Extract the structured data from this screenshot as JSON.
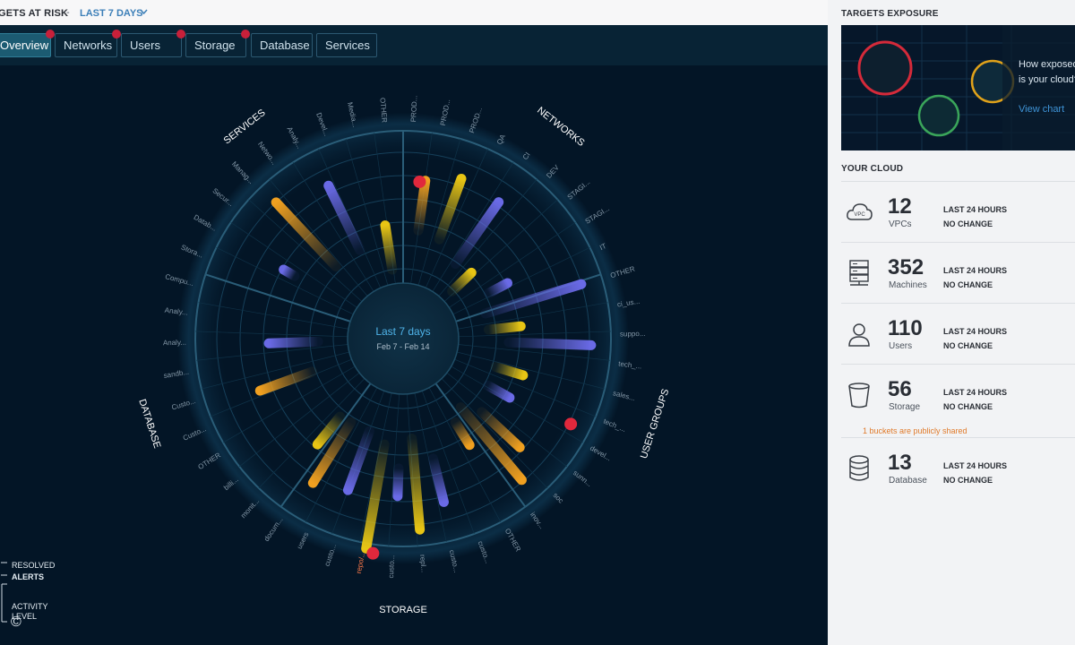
{
  "header": {
    "title": "GETS AT RISK",
    "separator": "-",
    "range_label": "LAST 7 DAYS"
  },
  "tabs": [
    {
      "label": "Overview",
      "active": true,
      "alert": true
    },
    {
      "label": "Networks",
      "active": false,
      "alert": true
    },
    {
      "label": "Users",
      "active": false,
      "alert": true
    },
    {
      "label": "Storage",
      "active": false,
      "alert": true
    },
    {
      "label": "Database",
      "active": false,
      "alert": false
    },
    {
      "label": "Services",
      "active": false,
      "alert": false
    }
  ],
  "radial": {
    "center_title": "Last 7 days",
    "center_dates": "Feb 7 - Feb 14",
    "sections": [
      "SERVICES",
      "NETWORKS",
      "USER GROUPS",
      "STORAGE",
      "DATABASE"
    ],
    "labels": [
      "OTHER",
      "PROD...",
      "PROD...",
      "PROD...",
      "QA",
      "CI",
      "DEV",
      "STAGI...",
      "STAGI...",
      "IT",
      "OTHER",
      "ci_us...",
      "suppo...",
      "tech_...",
      "sales...",
      "tech_...",
      "devel...",
      "sunn...",
      "soc",
      "inov...",
      "OTHER",
      "custo...",
      "custo...",
      "repl...",
      "custo...",
      "repo/...",
      "custo...",
      "users",
      "docum...",
      "monit...",
      "billi...",
      "OTHER",
      "Custo...",
      "Custo...",
      "sandb...",
      "Analy...",
      "Analy...",
      "Compu...",
      "Stora...",
      "Datab...",
      "Secur...",
      "Manag...",
      "Netwo...",
      "Analy...",
      "Devel...",
      "Media..."
    ],
    "highlight_label": "repo/...",
    "colors": {
      "orange": "#f0a020",
      "yellow": "#e8c514",
      "purple": "#6a6ae6",
      "red": "#e0283c",
      "accent": "#4fb3e8"
    }
  },
  "legend": {
    "resolved": "RESOLVED",
    "alerts": "ALERTS",
    "activity1": "ACTIVITY",
    "activity2": "LEVEL",
    "copyright": "©"
  },
  "right": {
    "exposure_title": "TARGETS EXPOSURE",
    "exposure_text1": "How exposed",
    "exposure_text2": "is your cloud?",
    "exposure_link": "View chart",
    "cloud_title": "YOUR CLOUD",
    "stats": [
      {
        "icon": "cloud-vpc-icon",
        "icon_text": "VPC",
        "value": "12",
        "label": "VPCs",
        "period": "LAST 24 HOURS",
        "change": "NO CHANGE"
      },
      {
        "icon": "server-rack-icon",
        "value": "352",
        "label": "Machines",
        "period": "LAST 24 HOURS",
        "change": "NO CHANGE"
      },
      {
        "icon": "user-icon",
        "value": "110",
        "label": "Users",
        "period": "LAST 24 HOURS",
        "change": "NO CHANGE"
      },
      {
        "icon": "bucket-icon",
        "value": "56",
        "label": "Storage",
        "period": "LAST 24 HOURS",
        "change": "NO CHANGE"
      },
      {
        "icon": "database-icon",
        "value": "13",
        "label": "Database",
        "period": "LAST 24 HOURS",
        "change": "NO CHANGE"
      }
    ],
    "storage_note": "1 buckets are publicly shared"
  }
}
